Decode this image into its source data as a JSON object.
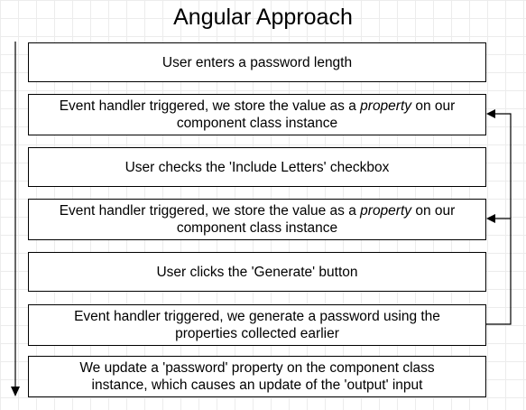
{
  "title": "Angular Approach",
  "steps": [
    {
      "text": "User enters a password length"
    },
    {
      "pre": "Event handler triggered, we store the value as a ",
      "em": "property",
      "post": " on our",
      "line2": "component class instance"
    },
    {
      "text": "User checks the 'Include Letters' checkbox"
    },
    {
      "pre": "Event handler triggered, we store the value as a ",
      "em": "property",
      "post": " on our",
      "line2": "component class instance"
    },
    {
      "text": "User clicks the 'Generate' button"
    },
    {
      "text": "Event handler triggered, we generate a password using the",
      "line2": "properties collected earlier"
    },
    {
      "text": "We update a 'password' property on the component class",
      "line2": "instance, which causes an update of the 'output' input"
    }
  ]
}
